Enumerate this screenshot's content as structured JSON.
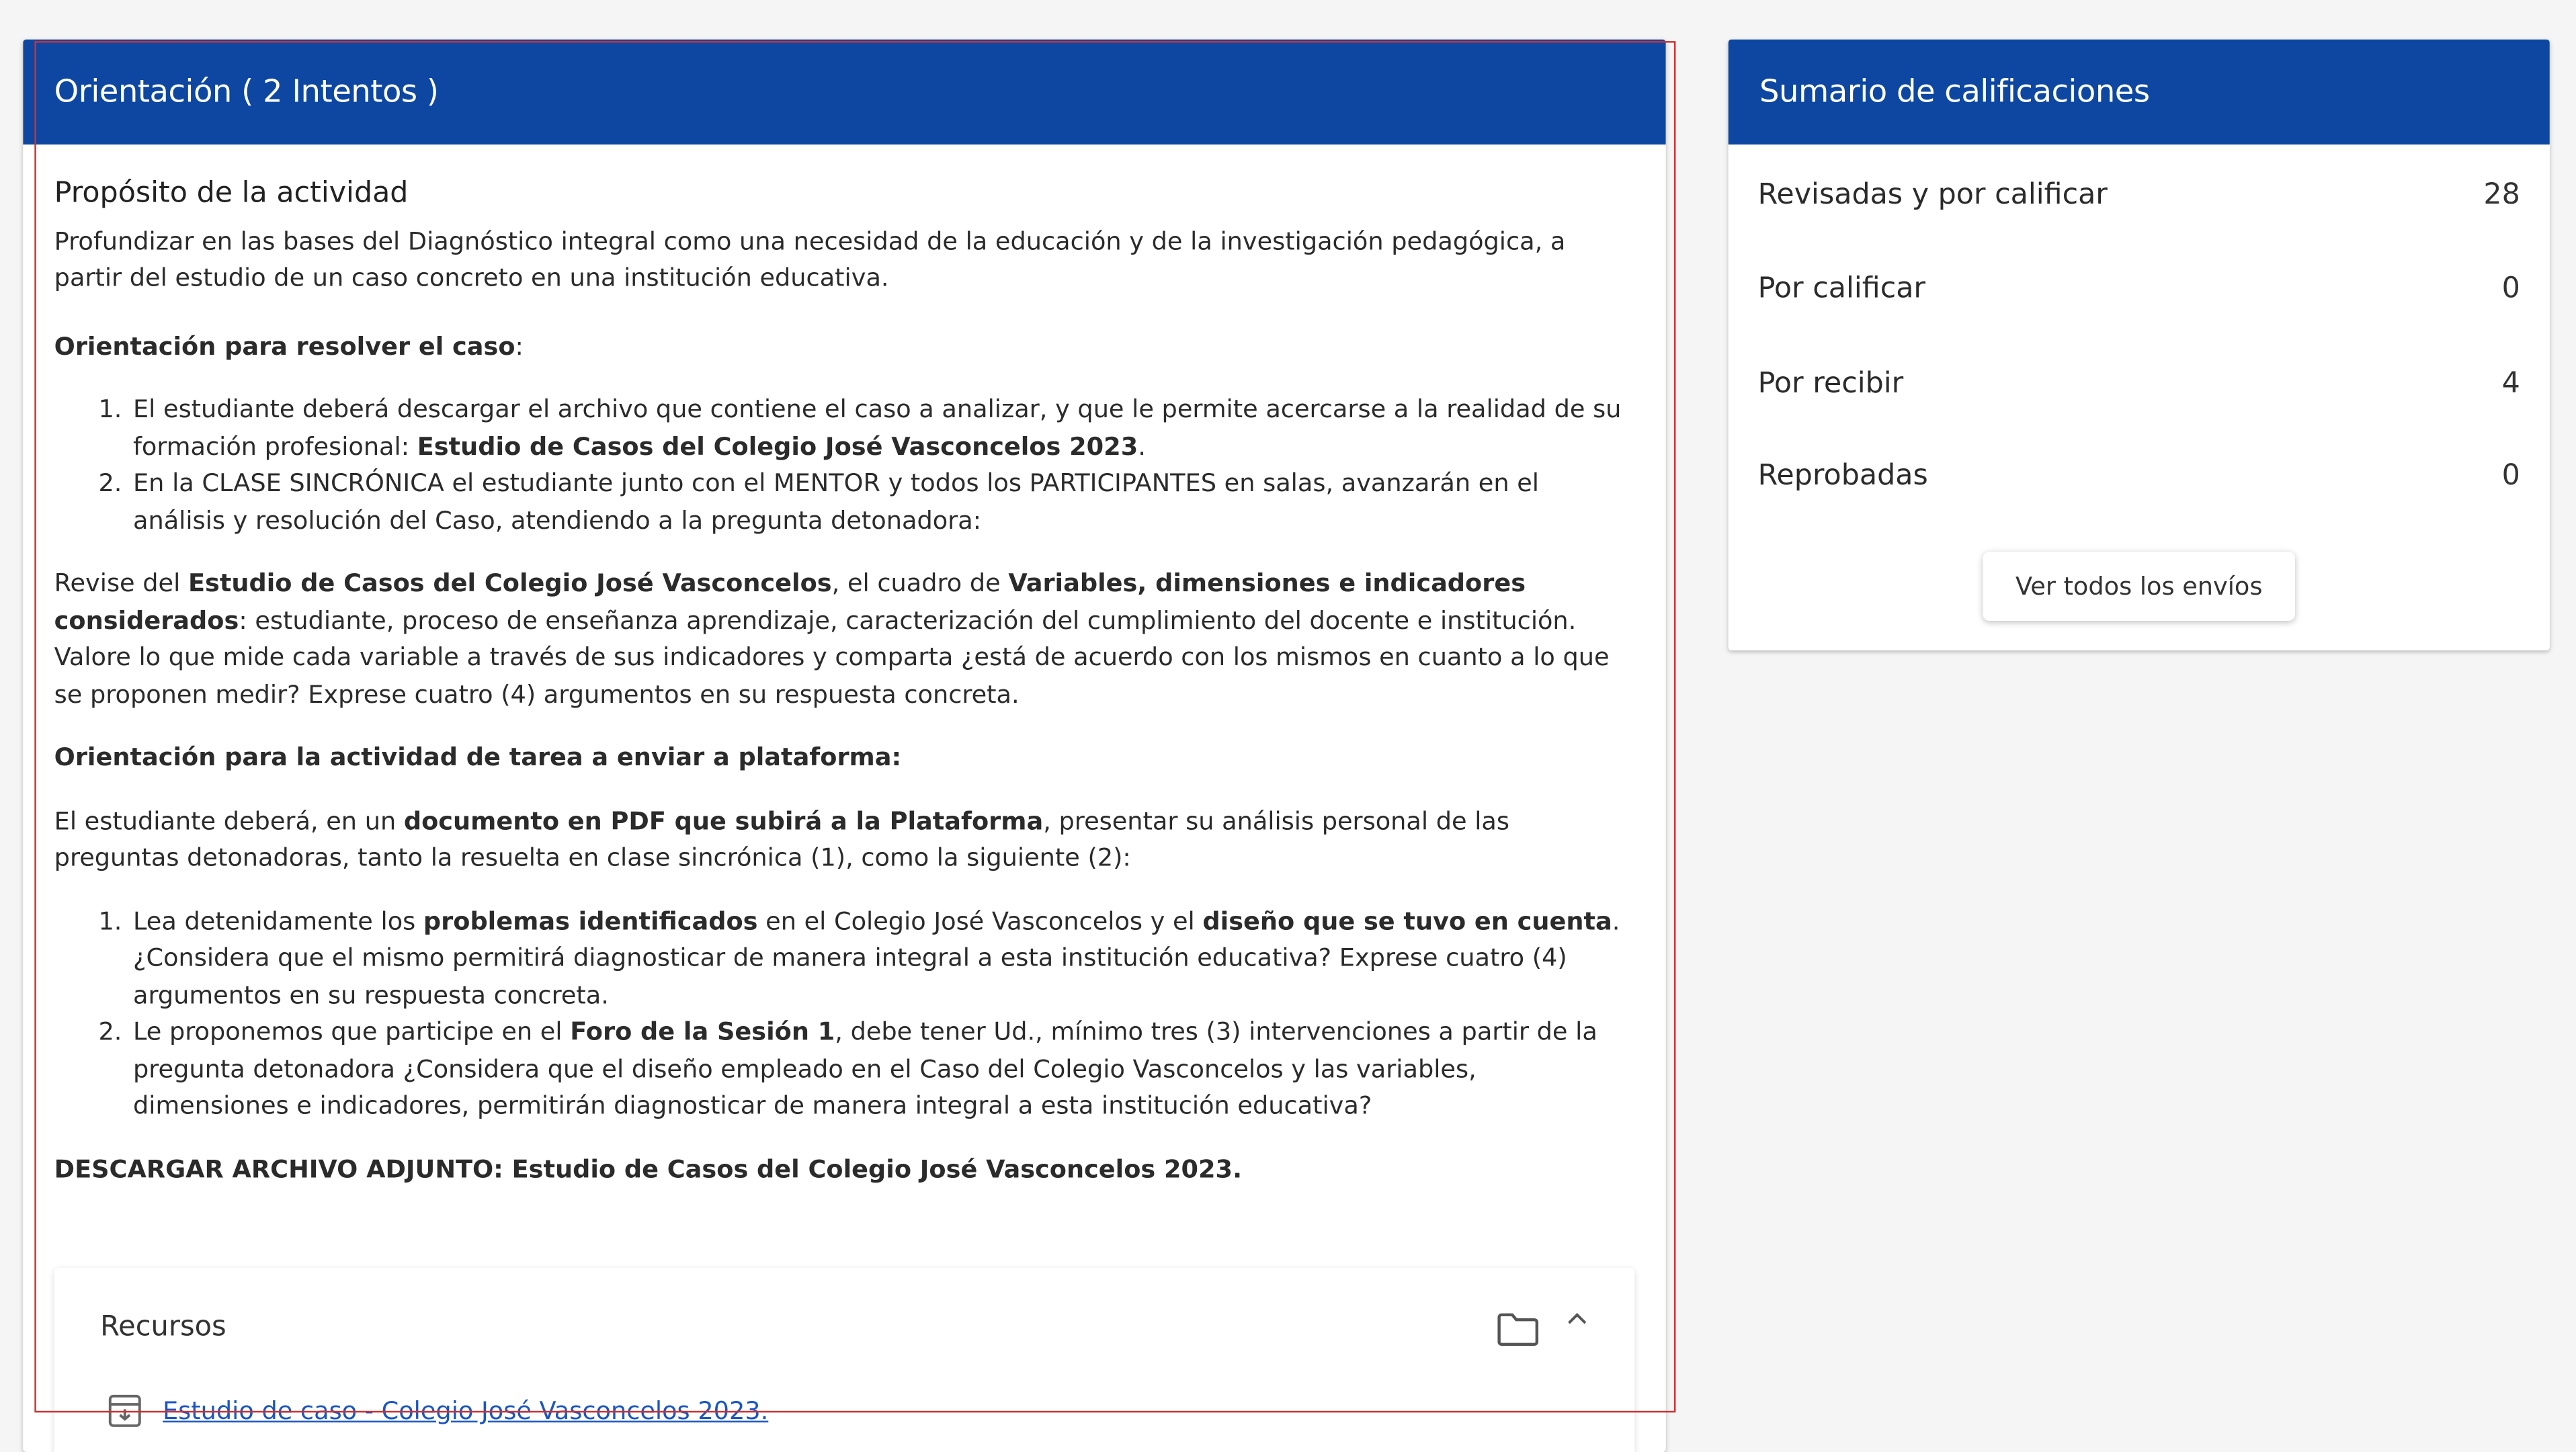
{
  "activity": {
    "header_title": "Orientación ( 2 Intentos )",
    "purpose_title": "Propósito de la actividad",
    "purpose_text": "Profundizar en las bases del Diagnóstico integral como una necesidad de la educación y de la investigación pedagógica, a partir del estudio de un caso concreto en una institución educativa.",
    "case_heading": "Orientación para resolver el caso",
    "case_heading_suffix": ":",
    "case_steps": [
      {
        "text": "El estudiante deberá descargar el archivo que contiene el caso a analizar, y que le permite acercarse a la realidad de su formación profesional: ",
        "bold": "Estudio de Casos del Colegio José Vasconcelos 2023",
        "after": "."
      },
      {
        "text": "En la CLASE SINCRÓNICA el estudiante junto con el MENTOR y todos los PARTICIPANTES en salas, avanzarán en el análisis y resolución del Caso, atendiendo a la pregunta detonadora:"
      }
    ],
    "review": {
      "t1": "Revise del ",
      "b1": "Estudio de Casos del Colegio José Vasconcelos",
      "t2": ", el cuadro de ",
      "b2": "Variables, dimensiones e indicadores considerados",
      "t3": ": estudiante, proceso de enseñanza aprendizaje, caracterización del cumplimiento del docente e institución. Valore lo que mide cada variable a través de sus indicadores y comparta ¿está de acuerdo con los mismos en cuanto a lo que se proponen medir? Exprese cuatro (4) argumentos en su respuesta concreta."
    },
    "task_heading": "Orientación para la actividad de tarea a enviar a plataforma:",
    "task_intro": {
      "t1": "El estudiante deberá, en un ",
      "b1": "documento en PDF que subirá a la Plataforma",
      "t2": ", presentar su análisis personal de las preguntas detonadoras, tanto la resuelta en clase sincrónica (1), como la siguiente (2):"
    },
    "task_steps": [
      {
        "t1": "Lea detenidamente los ",
        "b1": "problemas identificados",
        "t2": " en el Colegio José Vasconcelos y el ",
        "b2": "diseño que se tuvo en cuenta",
        "t3": ". ¿Considera que el mismo permitirá diagnosticar de manera integral a esta institución educativa? Exprese cuatro (4) argumentos en su respuesta concreta."
      },
      {
        "t1": "Le proponemos que participe en el ",
        "b1": "Foro de la Sesión 1",
        "t2": ", debe tener Ud., mínimo tres (3) intervenciones a partir de la pregunta detonadora ¿Considera que el diseño empleado en el Caso del Colegio Vasconcelos y las variables, dimensiones e indicadores, permitirán diagnosticar de manera integral a esta institución educativa?",
        "b2": "",
        "t3": ""
      }
    ],
    "download_label": "DESCARGAR ARCHIVO ADJUNTO: Estudio de Casos del Colegio José Vasconcelos 2023.",
    "resources": {
      "title": "Recursos",
      "folder_icon": "folder-icon",
      "collapse_icon": "chevron-up-icon",
      "items": [
        {
          "icon": "archive-file-icon",
          "label": "Estudio de caso - Colegio José Vasconcelos 2023."
        }
      ]
    }
  },
  "summary": {
    "header_title": "Sumario de calificaciones",
    "rows": [
      {
        "label": "Revisadas y por calificar",
        "count": "28"
      },
      {
        "label": "Por calificar",
        "count": "0"
      },
      {
        "label": "Por recibir",
        "count": "4"
      },
      {
        "label": "Reprobadas",
        "count": "0"
      }
    ],
    "view_all_label": "Ver todos los envíos"
  },
  "colors": {
    "header_bg": "#0d47a1",
    "link": "#1a56c2",
    "highlight_outline": "#d32f2f"
  }
}
